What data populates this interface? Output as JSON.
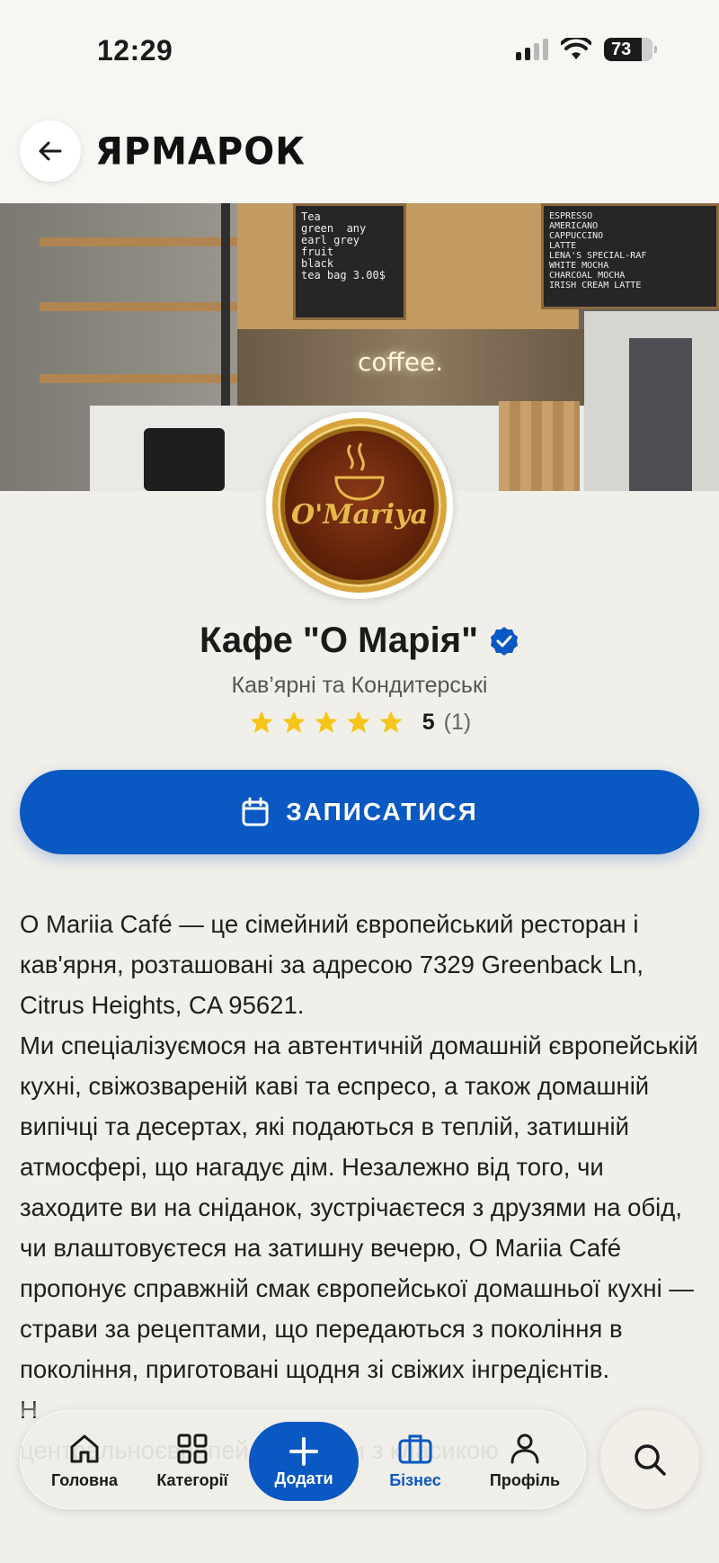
{
  "status_bar": {
    "time": "12:29",
    "battery": "73"
  },
  "header": {
    "logo": "ЯРМАРОК",
    "icons": [
      "back-arrow-icon"
    ]
  },
  "cover": {
    "sign_text": "coffee.",
    "board_tea": "Tea\ngreen  any\nearl grey\nfruit\nblack\ntea bag 3.00$",
    "board_menu": "ESPRESSO\nAMERICANO\nCAPPUCCINO\nLATTE\nLENA'S SPECIAL-RAF\nWHITE MOCHA\nCHARCOAL MOCHA\nIRISH CREAM LATTE"
  },
  "business": {
    "logo_text": "O'Mariya",
    "name": "Кафе \"О Марія\"",
    "verified": true,
    "category": "Кав’ярні та Кондитерські",
    "rating": 5,
    "rating_value": "5",
    "rating_count": "(1)"
  },
  "book_button": {
    "label": "ЗАПИСАТИСЯ",
    "icon": "calendar-icon"
  },
  "description": {
    "p1": "O Mariia Café — це сімейний європейський ресторан і кав'ярня, розташовані за адресою 7329 Greenback Ln, Citrus Heights, CA 95621.",
    "p2": "Ми спеціалізуємося на автентичній домашній європейській кухні, свіжозвареній каві та еспресо, а також домашній випічці та десертах, які подаються в теплій, затишній атмосфері, що нагадує дім. Незалежно від того, чи заходите ви на сніданок, зустрічаєтеся з друзями на обід, чи влаштовуєтеся на затишну вечерю, O Mariia Café пропонує справжній смак європейської домашньої кухні — страви за рецептами, що передаються з покоління в покоління, приготовані щодня зі свіжих інгредієнтів.",
    "p3": "Н",
    "p4": "центральноєвропейські смаки з класикою"
  },
  "bottom_nav": {
    "items": [
      {
        "label": "Головна",
        "icon": "home-icon"
      },
      {
        "label": "Категорії",
        "icon": "grid-icon"
      },
      {
        "label": "Додати",
        "icon": "plus-icon"
      },
      {
        "label": "Бізнес",
        "icon": "briefcase-icon",
        "active": true
      },
      {
        "label": "Профіль",
        "icon": "user-icon"
      }
    ],
    "search_icon": "search-icon"
  },
  "colors": {
    "accent": "#0a58c2",
    "background": "#f1efe9",
    "star": "#f5c518"
  }
}
